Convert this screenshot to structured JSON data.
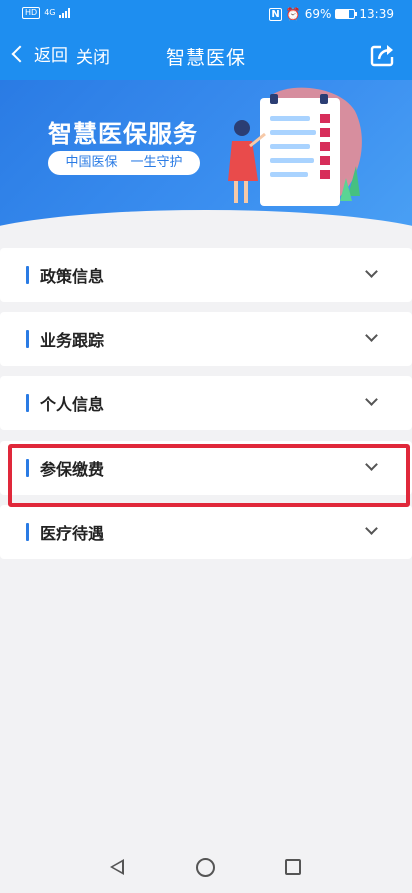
{
  "status_bar": {
    "hd": "HD",
    "network": "4G",
    "battery_percent": "69%",
    "battery_level": 0.69,
    "time": "13:39",
    "icons": [
      "signal-icon",
      "nfc-icon",
      "alarm-icon",
      "battery-icon"
    ]
  },
  "nav": {
    "back_label": "返回",
    "close_label": "关闭",
    "title": "智慧医保",
    "share_icon": "share-icon"
  },
  "banner": {
    "title": "智慧医保服务",
    "subtitle": "中国医保　一生守护"
  },
  "menu": {
    "items": [
      {
        "label": "政策信息"
      },
      {
        "label": "业务跟踪"
      },
      {
        "label": "个人信息"
      },
      {
        "label": "参保缴费"
      },
      {
        "label": "医疗待遇"
      }
    ],
    "highlighted_index": 3
  },
  "colors": {
    "primary": "#1e8ef0",
    "accent_bar": "#2a7be4",
    "highlight": "#e0283a",
    "background": "#f2f2f4"
  },
  "system_nav": {
    "icons": [
      "back-triangle-icon",
      "home-circle-icon",
      "recent-square-icon"
    ]
  }
}
